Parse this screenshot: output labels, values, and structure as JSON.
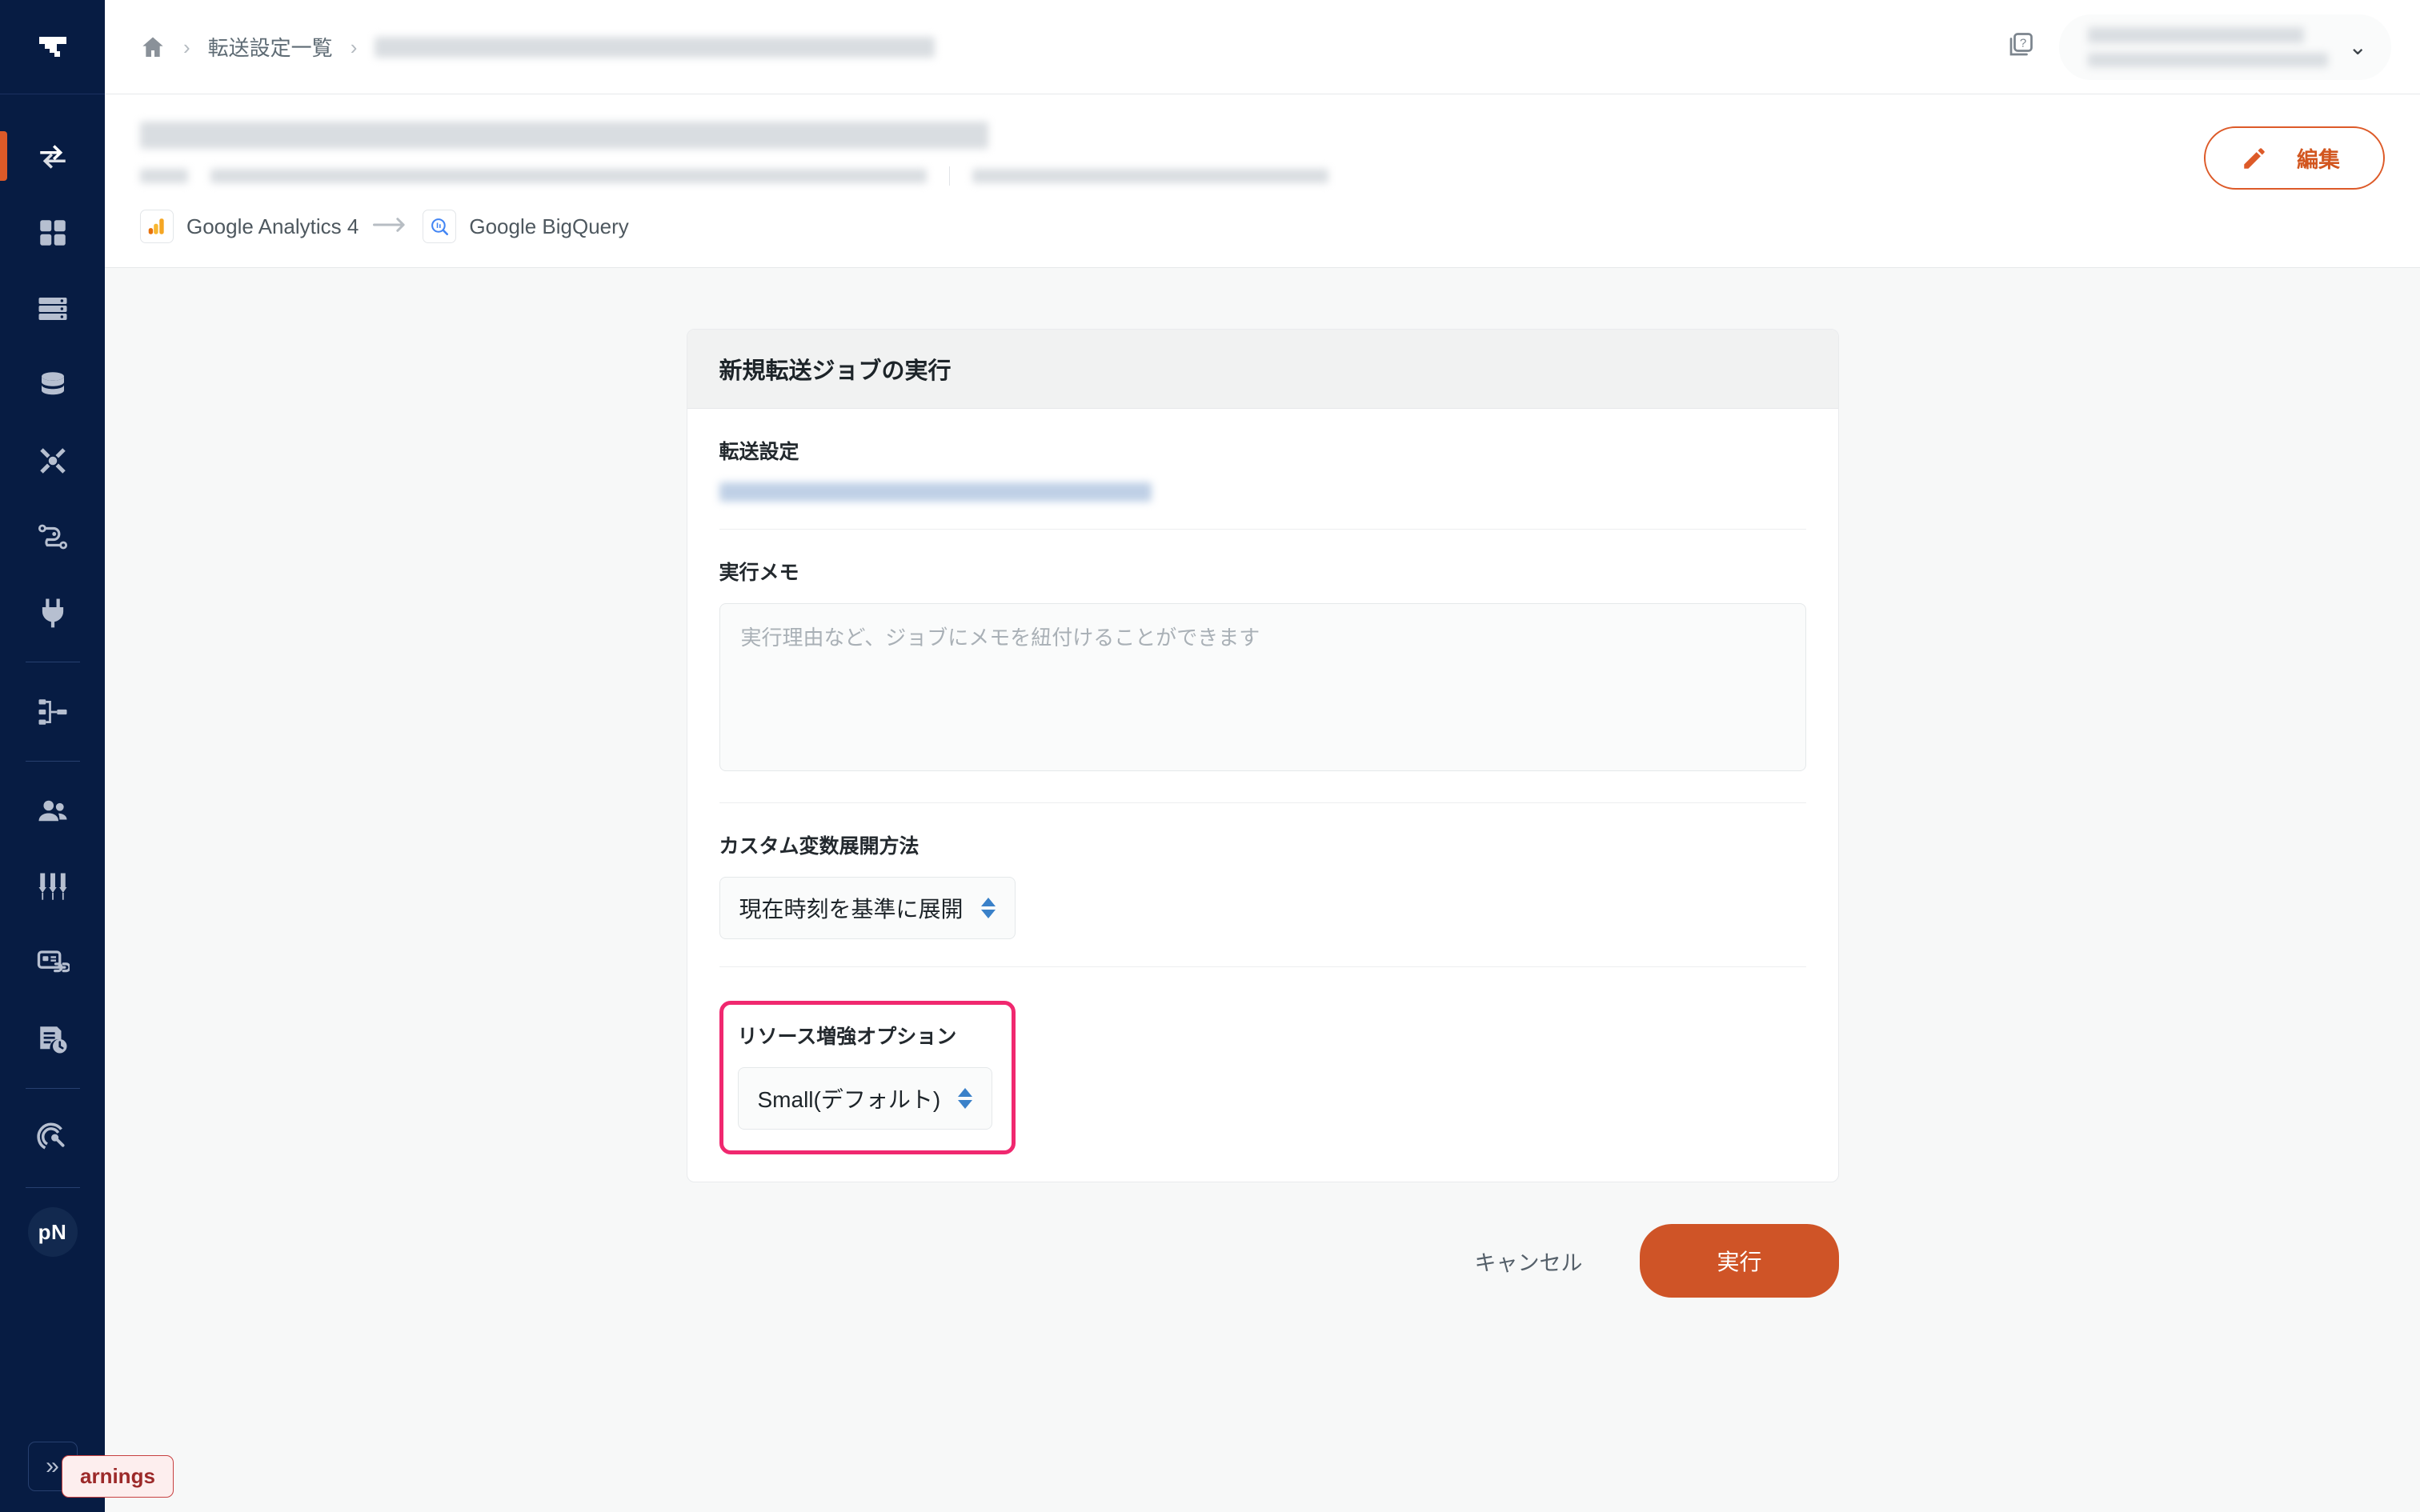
{
  "app": {
    "logo_name": "trocco-logo",
    "avatar_initials": "pN",
    "collapse_label": "»"
  },
  "sidebar": {
    "items": [
      {
        "name": "transfer",
        "icon": "transfer-arrows-icon",
        "active": true
      },
      {
        "name": "apps-grid",
        "icon": "grid-apps-icon",
        "active": false
      },
      {
        "name": "datamart",
        "icon": "server-list-icon",
        "active": false
      },
      {
        "name": "datasets",
        "icon": "database-stack-icon",
        "active": false
      },
      {
        "name": "workflow",
        "icon": "workflow-x-icon",
        "active": false
      },
      {
        "name": "pipeline",
        "icon": "pipeline-nodes-icon",
        "active": false
      },
      {
        "name": "connections",
        "icon": "plug-icon",
        "active": false
      },
      {
        "name": "lineage",
        "icon": "sitemap-icon",
        "active": false
      },
      {
        "name": "users",
        "icon": "users-icon",
        "active": false
      },
      {
        "name": "settings",
        "icon": "sliders-icon",
        "active": false
      },
      {
        "name": "card-link",
        "icon": "card-link-icon",
        "active": false
      },
      {
        "name": "audit-log",
        "icon": "document-clock-icon",
        "active": false
      },
      {
        "name": "search-radar",
        "icon": "radar-target-icon",
        "active": false
      }
    ]
  },
  "topbar": {
    "breadcrumb": {
      "home_icon": "home-icon",
      "separator": "›",
      "link_label": "転送設定一覧",
      "current_redacted": true
    },
    "help_icon": "help-question-icon",
    "user_menu": {
      "redacted": true,
      "chevron": "⌄"
    }
  },
  "pagehead": {
    "title_redacted": true,
    "subtitle_redacted": true,
    "connection": {
      "source_label": "Google Analytics 4",
      "source_icon": "google-analytics-icon",
      "arrow_icon": "arrow-right-icon",
      "destination_label": "Google BigQuery",
      "destination_icon": "google-bigquery-icon"
    },
    "edit_button": {
      "label": "編集",
      "icon": "pencil-icon",
      "color": "#dd5a28"
    }
  },
  "card": {
    "header": "新規転送ジョブの実行",
    "fields": {
      "transfer_setting": {
        "label": "転送設定",
        "value_redacted": true
      },
      "memo": {
        "label": "実行メモ",
        "value": "",
        "placeholder": "実行理由など、ジョブにメモを紐付けることができます"
      },
      "custom_variable": {
        "label": "カスタム変数展開方法",
        "selected": "現在時刻を基準に展開"
      },
      "resource_option": {
        "label": "リソース増強オプション",
        "selected": "Small(デフォルト)",
        "highlight_color": "#f0286f"
      }
    }
  },
  "actions": {
    "cancel_label": "キャンセル",
    "run_label": "実行",
    "run_color": "#cf5427"
  },
  "status": {
    "warnings_badge": "arnings"
  }
}
